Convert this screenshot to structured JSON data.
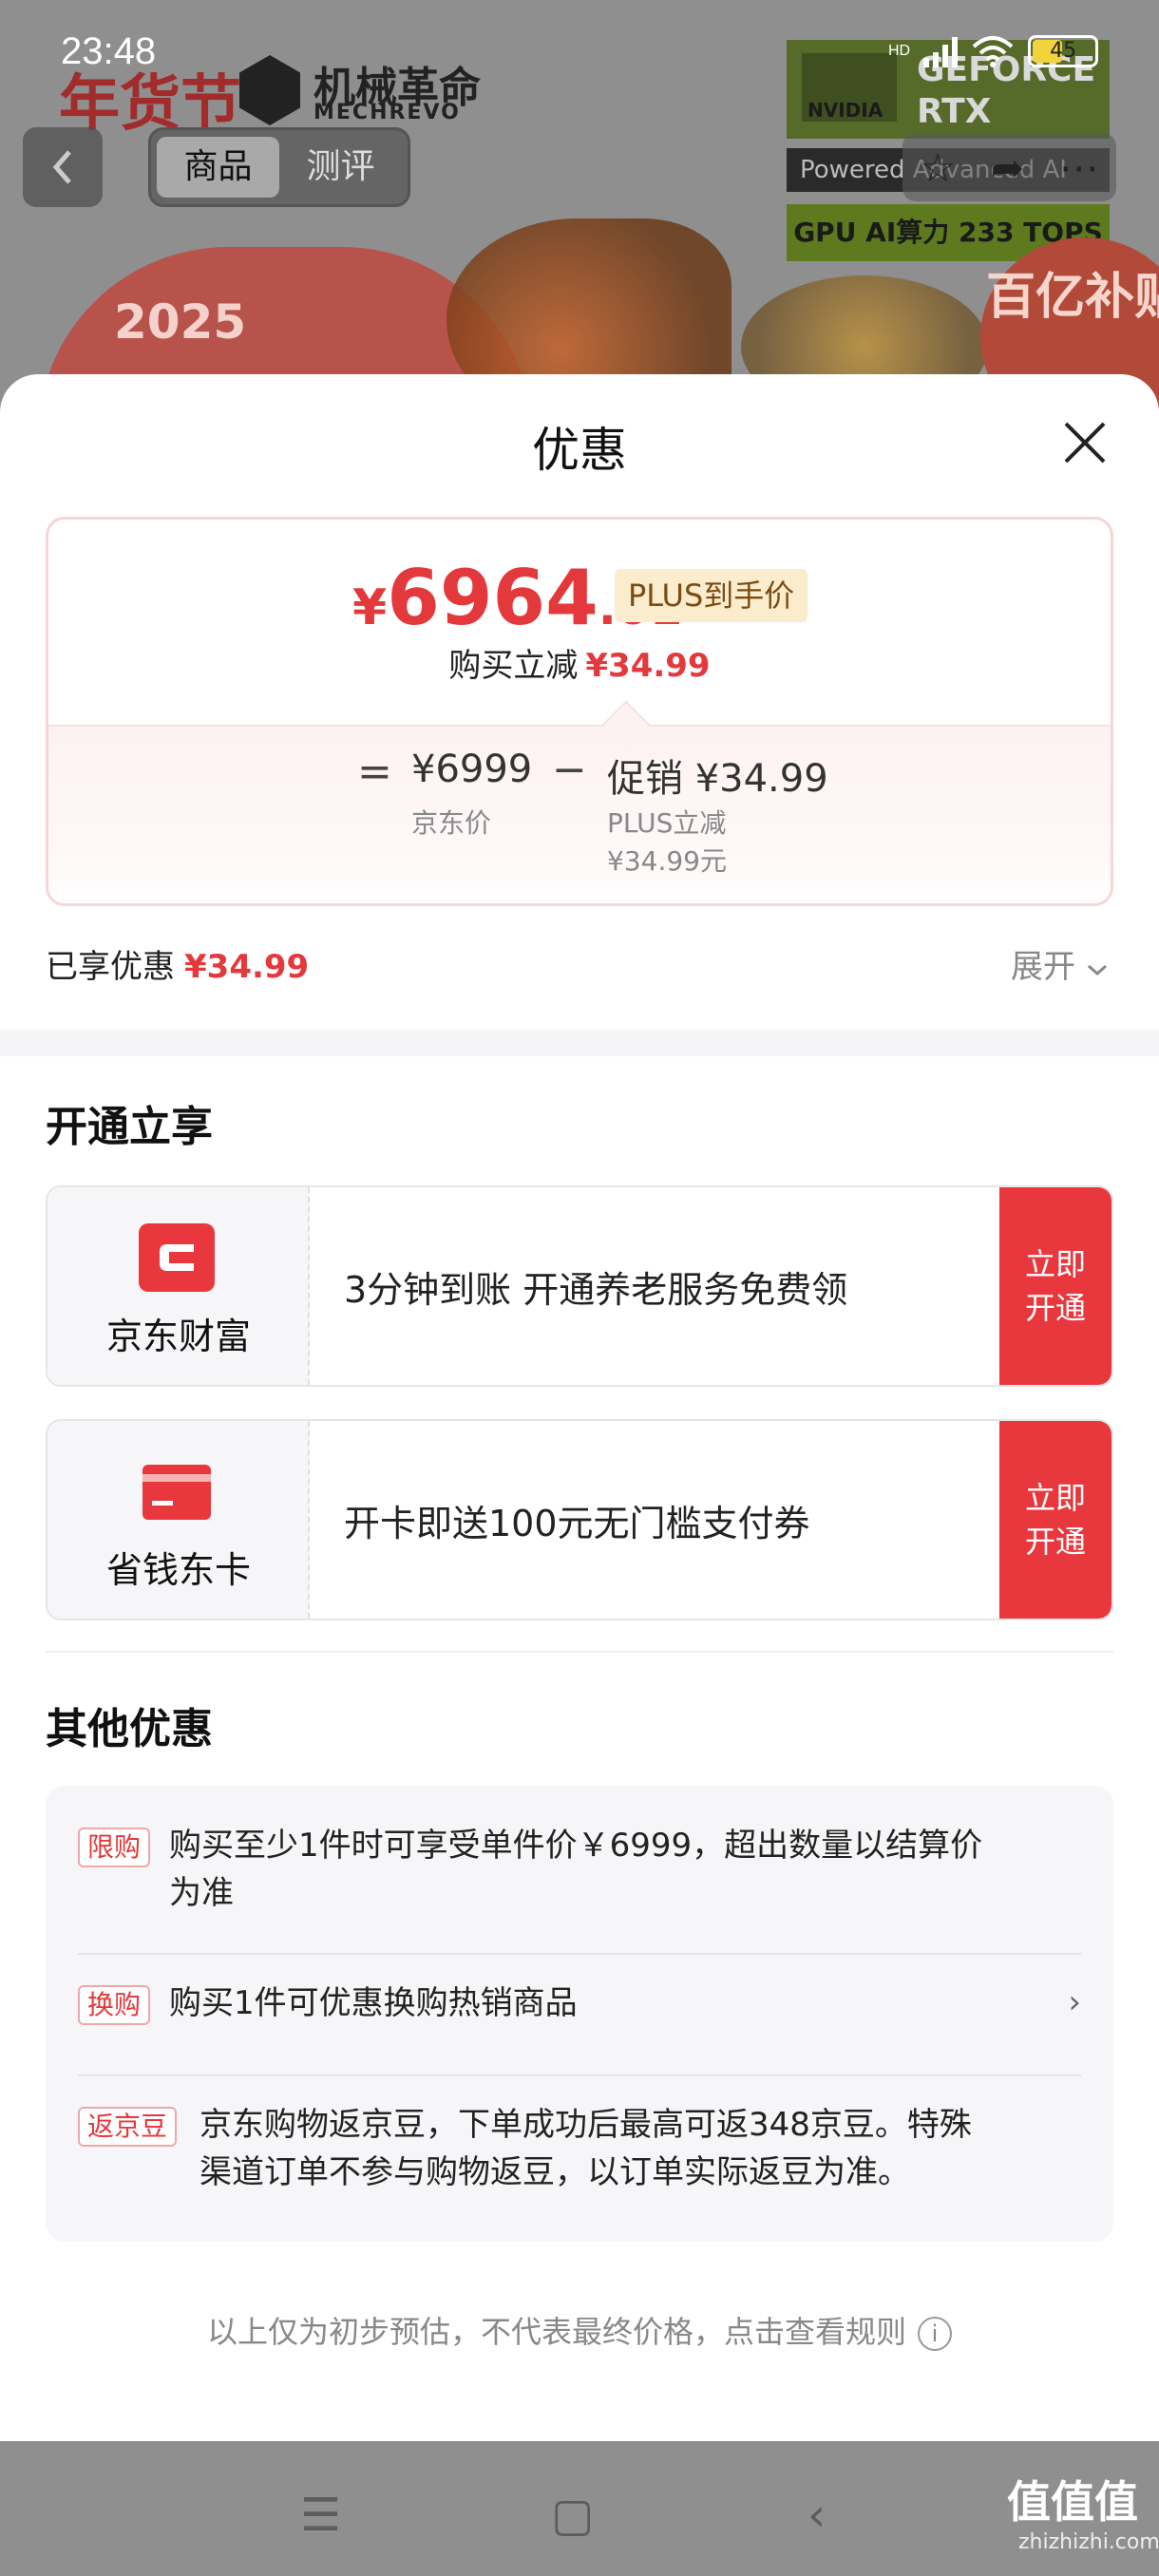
{
  "status_bar": {
    "time": "23:48",
    "network": "HD",
    "battery": "45"
  },
  "background": {
    "festival": "年货节",
    "brand_cn": "机械革命",
    "brand_en": "MECHREVO",
    "nvidia": "NVIDIA",
    "gpu_badge": "GEFORCE RTX",
    "powered": "Powered Advanced AI",
    "tops": "GPU AI算力 233 TOPS",
    "banner_year": "2025",
    "subsidy": "百亿补贴"
  },
  "header": {
    "tabs": [
      {
        "label": "商品",
        "active": true
      },
      {
        "label": "测评",
        "active": false
      }
    ]
  },
  "sheet": {
    "title": "优惠",
    "price_card": {
      "currency": "¥",
      "price_int": "6964",
      "price_dec": ".01",
      "plus_tag": "PLUS到手价",
      "reduce_label": "购买立减",
      "reduce_amount": "¥34.99",
      "equals": "=",
      "jd_price": "¥6999",
      "jd_label": "京东价",
      "minus": "−",
      "promo_price": "促销 ¥34.99",
      "promo_label": "PLUS立减",
      "promo_amount": "¥34.99元"
    },
    "enjoyed_label": "已享优惠",
    "enjoyed_amount": "¥34.99",
    "expand_label": "展开"
  },
  "open_section": {
    "title": "开通立享",
    "offers": [
      {
        "name": "京东财富",
        "desc": "3分钟到账 开通养老服务免费领",
        "cta": "立即开通"
      },
      {
        "name": "省钱东卡",
        "desc": "开卡即送100元无门槛支付券",
        "cta": "立即开通"
      }
    ]
  },
  "other_section": {
    "title": "其他优惠",
    "rows": [
      {
        "tag": "限购",
        "text_line1": "购买至少1件时可享受单件价￥6999，超出数量以结算价",
        "text_line2": "为准"
      },
      {
        "tag": "换购",
        "text": "购买1件可优惠换购热销商品",
        "arrow": "›"
      },
      {
        "tag": "返京豆",
        "text_line1": "京东购物返京豆，下单成功后最高可返348京豆。特殊",
        "text_line2": "渠道订单不参与购物返豆，以订单实际返豆为准。"
      }
    ]
  },
  "footnote": "以上仅为初步预估，不代表最终价格，点击查看规则",
  "watermark": {
    "main": "值值值",
    "sub": "zhizhizhi.com"
  },
  "colors": {
    "accent": "#e4393c",
    "cta": "#e8383d",
    "plus_tag_bg": "#fbeccd"
  }
}
